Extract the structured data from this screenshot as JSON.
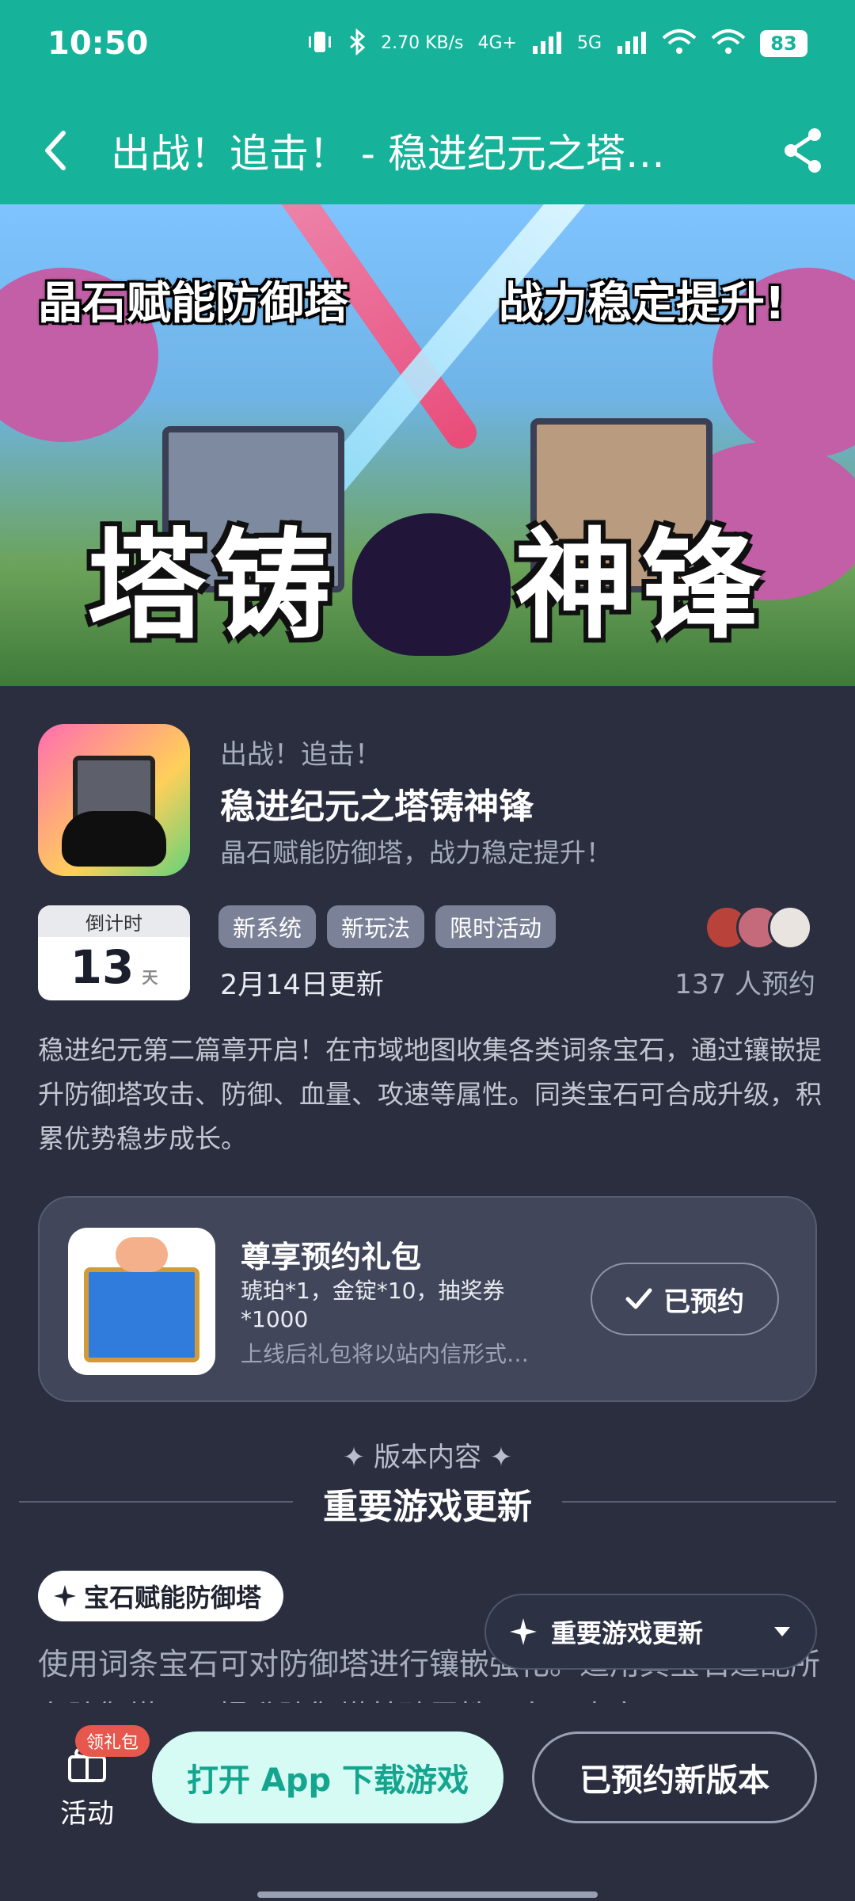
{
  "status_bar": {
    "time": "10:50",
    "net_speed": "2.70 KB/s",
    "network_1": "4G+",
    "network_2": "5G",
    "battery": "83"
  },
  "header": {
    "title": "出战！追击！ - 稳进纪元之塔…",
    "back_icon": "chevron-left-icon",
    "share_icon": "share-icon"
  },
  "banner": {
    "slogan_left": "晶石赋能防御塔",
    "slogan_right": "战力稳定提升!",
    "logo_left": "塔铸",
    "logo_right": "神锋"
  },
  "app": {
    "subtitle": "出战！追击！",
    "name": "稳进纪元之塔铸神锋",
    "slogan": "晶石赋能防御塔，战力稳定提升！"
  },
  "countdown": {
    "label": "倒计时",
    "value": "13",
    "unit": "天"
  },
  "tags": [
    "新系统",
    "新玩法",
    "限时活动"
  ],
  "update_date": "2月14日更新",
  "reserve_count": "137 人预约",
  "description": "稳进纪元第二篇章开启！在市域地图收集各类词条宝石，通过镶嵌提升防御塔攻击、防御、血量、攻速等属性。同类宝石可合成升级，积累优势稳步成长。",
  "gift": {
    "title": "尊享预约礼包",
    "items": "琥珀*1，金锭*10，抽奖券*1000",
    "note": "上线后礼包将以站内信形式…",
    "button_label": "已预约"
  },
  "version": {
    "label": "✦ 版本内容 ✦",
    "title": "重要游戏更新",
    "chip": "宝石赋能防御塔",
    "body": "使用词条宝石可对防御塔进行镶嵌强化。适用其宝石适配所有防御塔，可提升防御塔基础属性，在局米实"
  },
  "float_pill": {
    "label": "重要游戏更新"
  },
  "bottom": {
    "activity_label": "活动",
    "badge": "领礼包",
    "open_label": "打开 App 下载游戏",
    "booked_label": "已预约新版本"
  },
  "colors": {
    "header_bg": "#16b29a",
    "page_bg": "#2a2e3e",
    "accent": "#14a58f"
  }
}
